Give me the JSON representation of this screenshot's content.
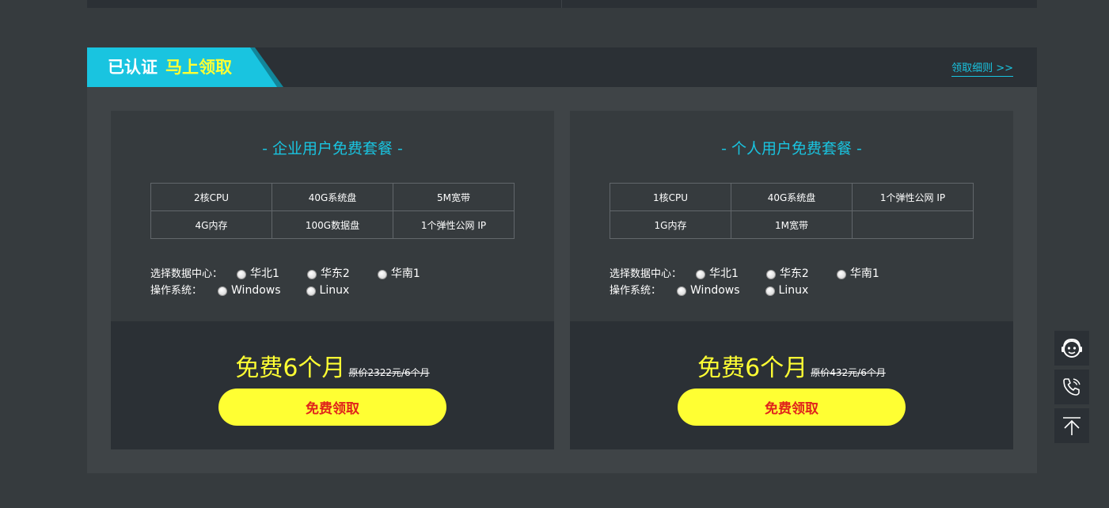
{
  "header": {
    "title_part1": "已认证",
    "title_part2": "马上领取",
    "rules_link": "领取细则 >>"
  },
  "cards": [
    {
      "title": "- 企业用户免费套餐 -",
      "specs": [
        [
          "2核CPU",
          "40G系统盘",
          "5M宽带"
        ],
        [
          "4G内存",
          "100G数据盘",
          "1个弹性公网 IP"
        ]
      ],
      "datacenter_label": "选择数据中心：",
      "datacenters": [
        "华北1",
        "华东2",
        "华南1"
      ],
      "os_label": "操作系统：",
      "os_options": [
        "Windows",
        "Linux"
      ],
      "price": "免费6个月",
      "original_price": "原价2322元/6个月",
      "button": "免费领取"
    },
    {
      "title": "- 个人用户免费套餐 -",
      "specs": [
        [
          "1核CPU",
          "40G系统盘",
          "1个弹性公网 IP"
        ],
        [
          "1G内存",
          "1M宽带",
          ""
        ]
      ],
      "datacenter_label": "选择数据中心：",
      "datacenters": [
        "华北1",
        "华东2",
        "华南1"
      ],
      "os_label": "操作系统：",
      "os_options": [
        "Windows",
        "Linux"
      ],
      "price": "免费6个月",
      "original_price": "原价432元/6个月",
      "button": "免费领取"
    }
  ],
  "side_toolbar": {
    "icons": [
      "customer-service-icon",
      "phone-icon",
      "back-to-top-icon"
    ]
  },
  "colors": {
    "accent_cyan": "#19c4e0",
    "highlight_yellow": "#ffff33",
    "button_text_red": "#e0241b",
    "dark_panel": "#2b3035"
  }
}
